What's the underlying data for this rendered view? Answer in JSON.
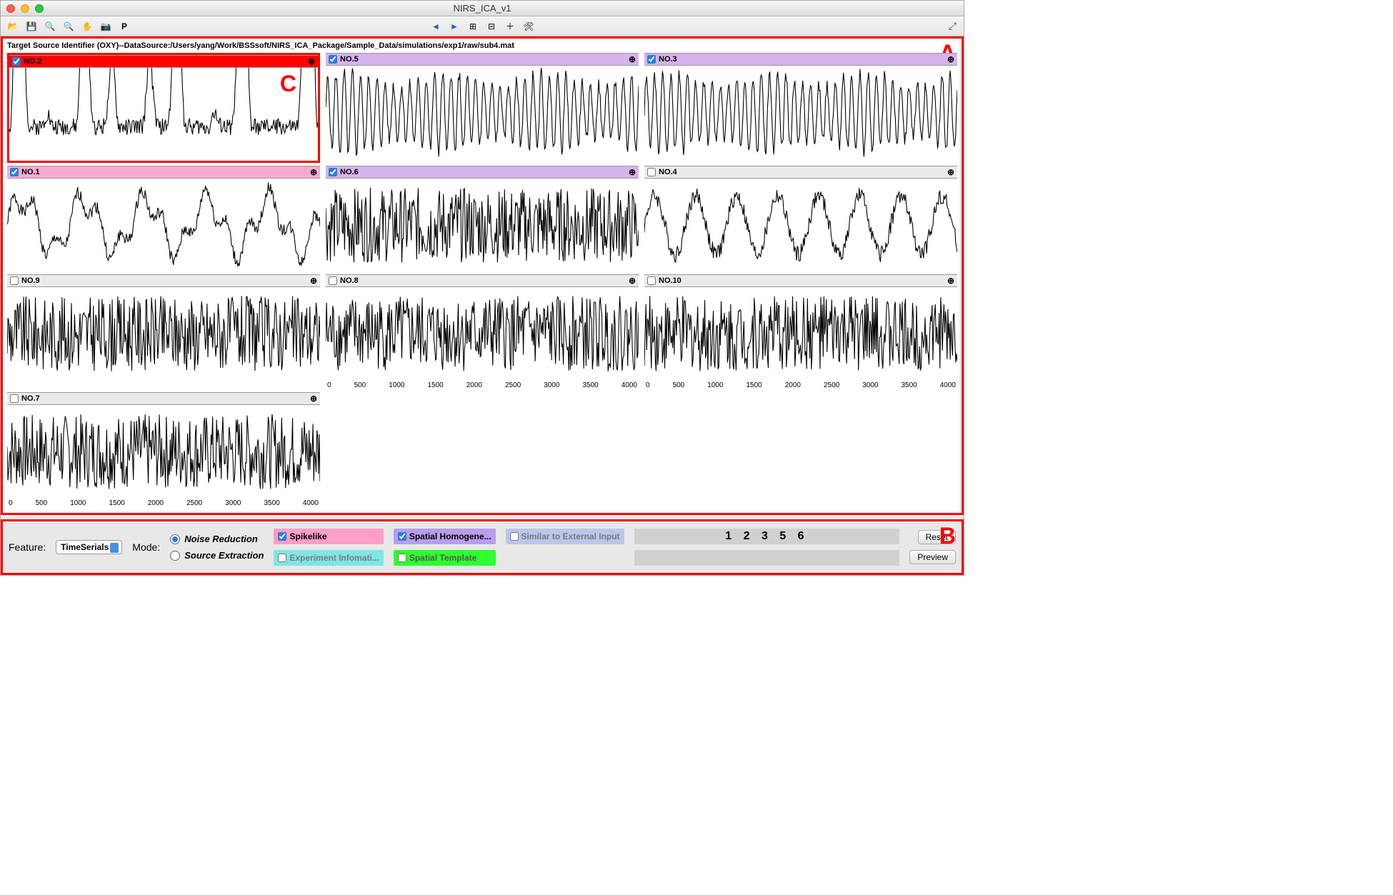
{
  "window": {
    "title": "NIRS_ICA_v1"
  },
  "toolbar": {
    "open_icon": "📂",
    "save_icon": "💾",
    "zoom_in_icon": "🔍",
    "zoom_out_icon": "🔍",
    "pan_icon": "✋",
    "camera_icon": "📷",
    "p_label": "P",
    "prev_icon": "◄",
    "next_icon": "►",
    "grid1_icon": "⊞",
    "grid2_icon": "⊟",
    "plus_icon": "＋",
    "tools_icon": "🛠",
    "expand_icon": "⤢"
  },
  "panelA": {
    "source_path": "Target Source Identifier (OXY)--DataSource:/Users/yang/Work/BSSsoft/NIRS_ICA_Package/Sample_Data/simulations/exp1/raw/sub4.mat",
    "label": "A"
  },
  "panelC": {
    "label": "C"
  },
  "panels": [
    {
      "label": "NO.2",
      "color": "red",
      "checked": true,
      "highlighted": true,
      "signal_type": "spiky",
      "seed": 2
    },
    {
      "label": "NO.5",
      "color": "purple",
      "checked": true,
      "highlighted": false,
      "signal_type": "osc",
      "seed": 5
    },
    {
      "label": "NO.3",
      "color": "purple",
      "checked": true,
      "highlighted": false,
      "signal_type": "osc",
      "seed": 3
    },
    {
      "label": "NO.1",
      "color": "pink",
      "checked": true,
      "highlighted": false,
      "signal_type": "slow",
      "seed": 1
    },
    {
      "label": "NO.6",
      "color": "purple",
      "checked": true,
      "highlighted": false,
      "signal_type": "noise",
      "seed": 6
    },
    {
      "label": "NO.4",
      "color": "gray",
      "checked": false,
      "highlighted": false,
      "signal_type": "wave",
      "seed": 4
    },
    {
      "label": "NO.9",
      "color": "gray",
      "checked": false,
      "highlighted": false,
      "signal_type": "noise",
      "seed": 9
    },
    {
      "label": "NO.8",
      "color": "gray",
      "checked": false,
      "highlighted": false,
      "signal_type": "noise",
      "seed": 8
    },
    {
      "label": "NO.10",
      "color": "gray",
      "checked": false,
      "highlighted": false,
      "signal_type": "noise",
      "seed": 10
    },
    {
      "label": "NO.7",
      "color": "gray",
      "checked": false,
      "highlighted": false,
      "signal_type": "noise",
      "seed": 7
    }
  ],
  "axis_ticks": [
    "0",
    "500",
    "1000",
    "1500",
    "2000",
    "2500",
    "3000",
    "3500",
    "4000"
  ],
  "panelB": {
    "label": "B",
    "feature_label": "Feature:",
    "feature_value": "TimeSerials",
    "mode_label": "Mode:",
    "modes": {
      "noise": "Noise Reduction",
      "source": "Source Extraction"
    },
    "tags": {
      "spikelike": "Spikelike",
      "spatial_homo": "Spatial Homogene...",
      "similar_ext": "Similar to External Input",
      "exp_info": "Experiment Infomati...",
      "spatial_template": "Spatial Template"
    },
    "selected_numbers": "1 2 3 5 6",
    "reset": "Reset",
    "preview": "Preview"
  },
  "zoom_icon": "⊕"
}
